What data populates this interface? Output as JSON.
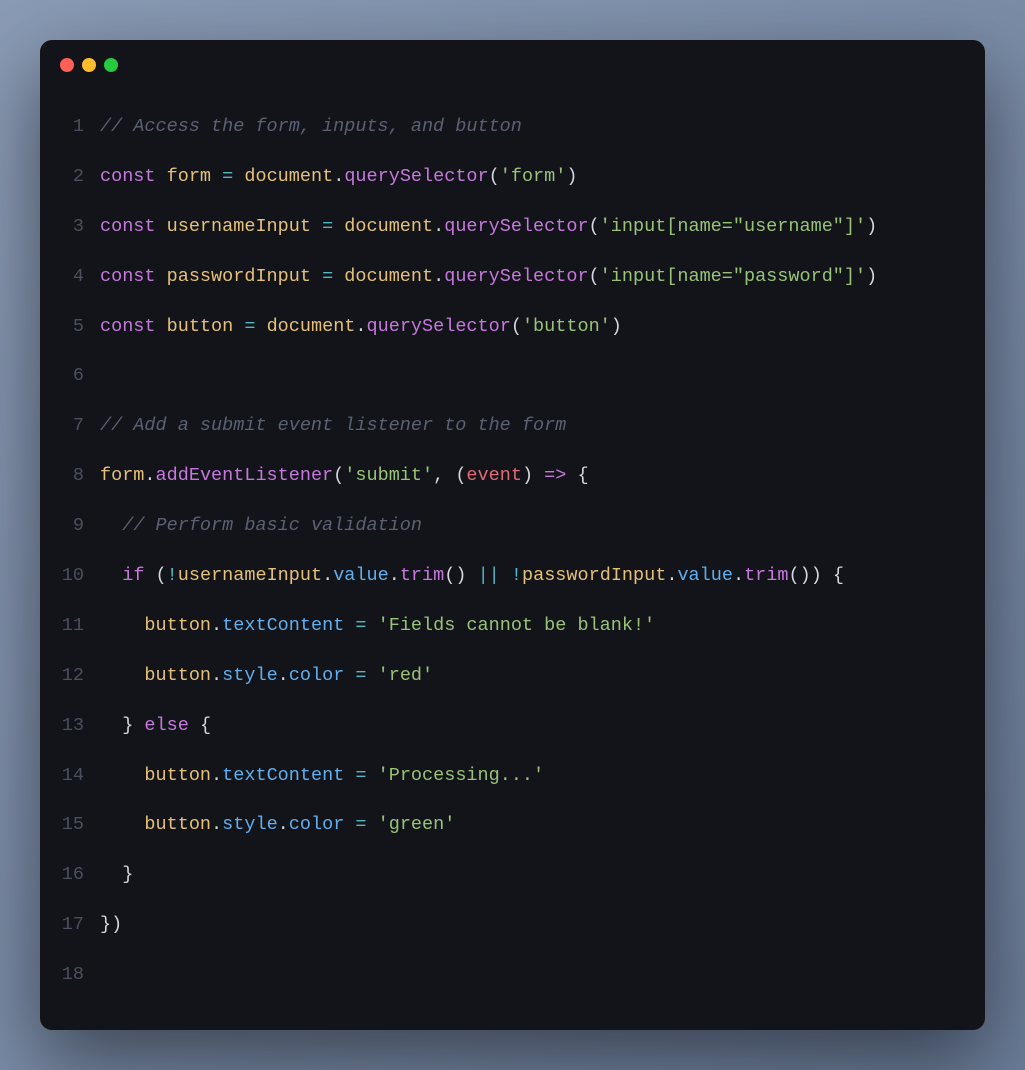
{
  "window": {
    "dots": [
      "red",
      "yellow",
      "green"
    ]
  },
  "code": {
    "lines": [
      {
        "n": "1",
        "tokens": [
          {
            "c": "tok-comment",
            "t": "// Access the form, inputs, and button"
          }
        ]
      },
      {
        "n": "2",
        "tokens": [
          {
            "c": "tok-keyword",
            "t": "const"
          },
          {
            "c": "tok-punct",
            "t": " "
          },
          {
            "c": "tok-ident",
            "t": "form"
          },
          {
            "c": "tok-punct",
            "t": " "
          },
          {
            "c": "tok-equals",
            "t": "="
          },
          {
            "c": "tok-punct",
            "t": " "
          },
          {
            "c": "tok-ident",
            "t": "document"
          },
          {
            "c": "tok-punct",
            "t": "."
          },
          {
            "c": "tok-method",
            "t": "querySelector"
          },
          {
            "c": "tok-punct",
            "t": "("
          },
          {
            "c": "tok-string",
            "t": "'form'"
          },
          {
            "c": "tok-punct",
            "t": ")"
          }
        ]
      },
      {
        "n": "3",
        "tokens": [
          {
            "c": "tok-keyword",
            "t": "const"
          },
          {
            "c": "tok-punct",
            "t": " "
          },
          {
            "c": "tok-ident",
            "t": "usernameInput"
          },
          {
            "c": "tok-punct",
            "t": " "
          },
          {
            "c": "tok-equals",
            "t": "="
          },
          {
            "c": "tok-punct",
            "t": " "
          },
          {
            "c": "tok-ident",
            "t": "document"
          },
          {
            "c": "tok-punct",
            "t": "."
          },
          {
            "c": "tok-method",
            "t": "querySelector"
          },
          {
            "c": "tok-punct",
            "t": "("
          },
          {
            "c": "tok-string",
            "t": "'input[name=\"username\"]'"
          },
          {
            "c": "tok-punct",
            "t": ")"
          }
        ]
      },
      {
        "n": "4",
        "tokens": [
          {
            "c": "tok-keyword",
            "t": "const"
          },
          {
            "c": "tok-punct",
            "t": " "
          },
          {
            "c": "tok-ident",
            "t": "passwordInput"
          },
          {
            "c": "tok-punct",
            "t": " "
          },
          {
            "c": "tok-equals",
            "t": "="
          },
          {
            "c": "tok-punct",
            "t": " "
          },
          {
            "c": "tok-ident",
            "t": "document"
          },
          {
            "c": "tok-punct",
            "t": "."
          },
          {
            "c": "tok-method",
            "t": "querySelector"
          },
          {
            "c": "tok-punct",
            "t": "("
          },
          {
            "c": "tok-string",
            "t": "'input[name=\"password\"]'"
          },
          {
            "c": "tok-punct",
            "t": ")"
          }
        ]
      },
      {
        "n": "5",
        "tokens": [
          {
            "c": "tok-keyword",
            "t": "const"
          },
          {
            "c": "tok-punct",
            "t": " "
          },
          {
            "c": "tok-ident",
            "t": "button"
          },
          {
            "c": "tok-punct",
            "t": " "
          },
          {
            "c": "tok-equals",
            "t": "="
          },
          {
            "c": "tok-punct",
            "t": " "
          },
          {
            "c": "tok-ident",
            "t": "document"
          },
          {
            "c": "tok-punct",
            "t": "."
          },
          {
            "c": "tok-method",
            "t": "querySelector"
          },
          {
            "c": "tok-punct",
            "t": "("
          },
          {
            "c": "tok-string",
            "t": "'button'"
          },
          {
            "c": "tok-punct",
            "t": ")"
          }
        ]
      },
      {
        "n": "6",
        "tokens": []
      },
      {
        "n": "7",
        "tokens": [
          {
            "c": "tok-comment",
            "t": "// Add a submit event listener to the form"
          }
        ]
      },
      {
        "n": "8",
        "tokens": [
          {
            "c": "tok-ident",
            "t": "form"
          },
          {
            "c": "tok-punct",
            "t": "."
          },
          {
            "c": "tok-method",
            "t": "addEventListener"
          },
          {
            "c": "tok-punct",
            "t": "("
          },
          {
            "c": "tok-string",
            "t": "'submit'"
          },
          {
            "c": "tok-punct",
            "t": ", ("
          },
          {
            "c": "tok-param",
            "t": "event"
          },
          {
            "c": "tok-punct",
            "t": ") "
          },
          {
            "c": "tok-arrow",
            "t": "=>"
          },
          {
            "c": "tok-punct",
            "t": " {"
          }
        ]
      },
      {
        "n": "9",
        "tokens": [
          {
            "c": "tok-punct",
            "t": "  "
          },
          {
            "c": "tok-comment",
            "t": "// Perform basic validation"
          }
        ]
      },
      {
        "n": "10",
        "tokens": [
          {
            "c": "tok-punct",
            "t": "  "
          },
          {
            "c": "tok-keyword",
            "t": "if"
          },
          {
            "c": "tok-punct",
            "t": " ("
          },
          {
            "c": "tok-op",
            "t": "!"
          },
          {
            "c": "tok-ident",
            "t": "usernameInput"
          },
          {
            "c": "tok-punct",
            "t": "."
          },
          {
            "c": "tok-prop",
            "t": "value"
          },
          {
            "c": "tok-punct",
            "t": "."
          },
          {
            "c": "tok-method",
            "t": "trim"
          },
          {
            "c": "tok-punct",
            "t": "() "
          },
          {
            "c": "tok-op",
            "t": "||"
          },
          {
            "c": "tok-punct",
            "t": " "
          },
          {
            "c": "tok-op",
            "t": "!"
          },
          {
            "c": "tok-ident",
            "t": "passwordInput"
          },
          {
            "c": "tok-punct",
            "t": "."
          },
          {
            "c": "tok-prop",
            "t": "value"
          },
          {
            "c": "tok-punct",
            "t": "."
          },
          {
            "c": "tok-method",
            "t": "trim"
          },
          {
            "c": "tok-punct",
            "t": "()) {"
          }
        ]
      },
      {
        "n": "11",
        "tokens": [
          {
            "c": "tok-punct",
            "t": "    "
          },
          {
            "c": "tok-ident",
            "t": "button"
          },
          {
            "c": "tok-punct",
            "t": "."
          },
          {
            "c": "tok-prop",
            "t": "textContent"
          },
          {
            "c": "tok-punct",
            "t": " "
          },
          {
            "c": "tok-equals",
            "t": "="
          },
          {
            "c": "tok-punct",
            "t": " "
          },
          {
            "c": "tok-string",
            "t": "'Fields cannot be blank!'"
          }
        ]
      },
      {
        "n": "12",
        "tokens": [
          {
            "c": "tok-punct",
            "t": "    "
          },
          {
            "c": "tok-ident",
            "t": "button"
          },
          {
            "c": "tok-punct",
            "t": "."
          },
          {
            "c": "tok-prop",
            "t": "style"
          },
          {
            "c": "tok-punct",
            "t": "."
          },
          {
            "c": "tok-prop",
            "t": "color"
          },
          {
            "c": "tok-punct",
            "t": " "
          },
          {
            "c": "tok-equals",
            "t": "="
          },
          {
            "c": "tok-punct",
            "t": " "
          },
          {
            "c": "tok-string",
            "t": "'red'"
          }
        ]
      },
      {
        "n": "13",
        "tokens": [
          {
            "c": "tok-punct",
            "t": "  } "
          },
          {
            "c": "tok-keyword",
            "t": "else"
          },
          {
            "c": "tok-punct",
            "t": " {"
          }
        ]
      },
      {
        "n": "14",
        "tokens": [
          {
            "c": "tok-punct",
            "t": "    "
          },
          {
            "c": "tok-ident",
            "t": "button"
          },
          {
            "c": "tok-punct",
            "t": "."
          },
          {
            "c": "tok-prop",
            "t": "textContent"
          },
          {
            "c": "tok-punct",
            "t": " "
          },
          {
            "c": "tok-equals",
            "t": "="
          },
          {
            "c": "tok-punct",
            "t": " "
          },
          {
            "c": "tok-string",
            "t": "'Processing...'"
          }
        ]
      },
      {
        "n": "15",
        "tokens": [
          {
            "c": "tok-punct",
            "t": "    "
          },
          {
            "c": "tok-ident",
            "t": "button"
          },
          {
            "c": "tok-punct",
            "t": "."
          },
          {
            "c": "tok-prop",
            "t": "style"
          },
          {
            "c": "tok-punct",
            "t": "."
          },
          {
            "c": "tok-prop",
            "t": "color"
          },
          {
            "c": "tok-punct",
            "t": " "
          },
          {
            "c": "tok-equals",
            "t": "="
          },
          {
            "c": "tok-punct",
            "t": " "
          },
          {
            "c": "tok-string",
            "t": "'green'"
          }
        ]
      },
      {
        "n": "16",
        "tokens": [
          {
            "c": "tok-punct",
            "t": "  }"
          }
        ]
      },
      {
        "n": "17",
        "tokens": [
          {
            "c": "tok-punct",
            "t": "})"
          }
        ]
      },
      {
        "n": "18",
        "tokens": []
      }
    ]
  }
}
